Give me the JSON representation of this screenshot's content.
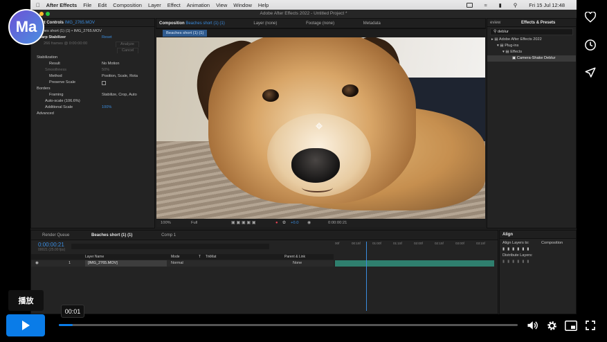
{
  "player": {
    "avatar_text": "Ma",
    "play_tooltip": "播放",
    "hover_time": "00:01",
    "progress_fraction": 0.03,
    "accent": "#0a7ce8",
    "side_icons": [
      "heart-icon",
      "clock-icon",
      "send-icon"
    ],
    "control_icons": [
      "volume-icon",
      "gear-icon",
      "pip-icon",
      "fullscreen-icon"
    ]
  },
  "menubar": {
    "items": [
      "After Effects",
      "File",
      "Edit",
      "Composition",
      "Layer",
      "Effect",
      "Animation",
      "View",
      "Window",
      "Help"
    ],
    "clock": "Fri 15 Jul  12:48"
  },
  "ae": {
    "window_title": "Adobe After Effects 2022 - Untitled Project *",
    "effect_controls": {
      "tab_label": "Effect Controls",
      "tab_file": "IMG_2765.MOV",
      "breadcrumb": "Beaches short (1) (1) • IMG_2765.MOV",
      "effect_name": "Warp Stabilizer",
      "reset": "Reset",
      "analyzing": "266 frames @ 0:00:00:00",
      "analyze_btn": "Analyze",
      "cancel_btn": "Cancel",
      "rows": [
        {
          "label": "Stabilization",
          "value": ""
        },
        {
          "label": "Result",
          "value": "No Motion"
        },
        {
          "label": "Smoothness",
          "value": "50%"
        },
        {
          "label": "Method",
          "value": "Position, Scale, Rota"
        },
        {
          "label": "Preserve Scale",
          "value": ""
        },
        {
          "label": "Borders",
          "value": ""
        },
        {
          "label": "Framing",
          "value": "Stabilize, Crop, Auto"
        },
        {
          "label": "Auto-scale (106.6%)",
          "value": ""
        },
        {
          "label": "Additional Scale",
          "value": "100%"
        },
        {
          "label": "Advanced",
          "value": ""
        }
      ]
    },
    "composition": {
      "tab_label": "Composition",
      "tab_name": "Beaches short (1) (1)",
      "layer_tab": "Layer (none)",
      "footage_tab": "Footage (none)",
      "metadata_tab": "Metadata",
      "chip": "Beaches short (1) (1)",
      "zoom": "100%",
      "resolution": "Full",
      "exposure": "+0.0",
      "timecode": "0:00:00:21"
    },
    "effects_presets": {
      "tab_left": "eview",
      "tab_label": "Effects & Presets",
      "search_value": "deblur",
      "tree": [
        "Adobe After Effects 2022",
        "Plug-ins",
        "Effects",
        "Camera-Shake Deblur"
      ]
    },
    "timeline": {
      "render_queue": "Render Queue",
      "comp_tab": "Beaches short (1) (1)",
      "comp1_tab": "Comp 1",
      "current_time": "0:00:00:21",
      "frame_info": "00021 (25.00 fps)",
      "col_layer_name": "Layer Name",
      "col_mode": "Mode",
      "col_t": "T",
      "col_trkmat": "TrkMat",
      "col_parent": "Parent & Link",
      "layer_index": "1",
      "layer_name": "[IMG_2765.MOV]",
      "layer_mode": "Normal",
      "layer_parent": "None",
      "ruler": [
        "00f",
        "00:15f",
        "01:00f",
        "01:15f",
        "02:00f",
        "02:15f",
        "03:00f",
        "03:15f",
        "04:00f",
        "04:15f"
      ]
    },
    "align": {
      "tab_label": "Align",
      "align_to_label": "Align Layers to:",
      "align_to_value": "Composition",
      "distribute_label": "Distribute Layers:"
    }
  }
}
